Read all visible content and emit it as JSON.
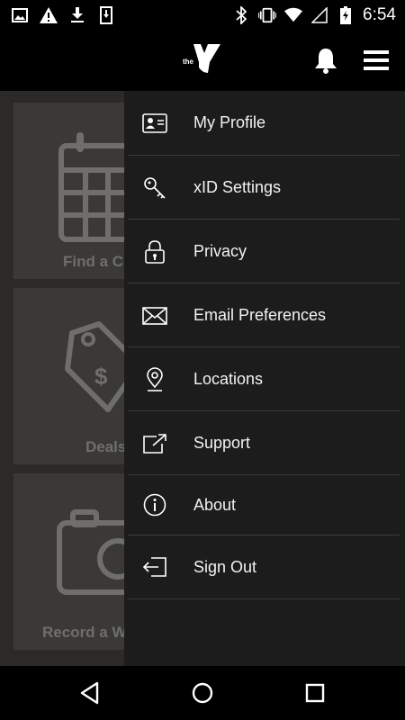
{
  "status_bar": {
    "time": "6:54",
    "icons": [
      "image-icon",
      "warning-icon",
      "download-icon",
      "phone-download-icon",
      "bluetooth-icon",
      "vibrate-icon",
      "wifi-icon",
      "battery-icon"
    ]
  },
  "app_bar": {
    "logo_text": "the",
    "icons": [
      "ymca-logo-icon",
      "bell-icon",
      "hamburger-menu-icon"
    ]
  },
  "background_tiles": [
    {
      "label": "Find a Cl",
      "icon": "calendar-icon"
    },
    {
      "label": "Deals",
      "icon": "price-tag-icon"
    },
    {
      "label": "Record a W",
      "icon": "camera-icon"
    }
  ],
  "drawer": {
    "items": [
      {
        "label": "My Profile",
        "icon": "id-card-icon"
      },
      {
        "label": "xID Settings",
        "icon": "key-icon"
      },
      {
        "label": "Privacy",
        "icon": "lock-icon"
      },
      {
        "label": "Email Preferences",
        "icon": "envelope-icon"
      },
      {
        "label": "Locations",
        "icon": "map-pin-icon"
      },
      {
        "label": "Support",
        "icon": "external-link-icon"
      },
      {
        "label": "About",
        "icon": "info-icon"
      },
      {
        "label": "Sign Out",
        "icon": "sign-out-icon"
      }
    ]
  },
  "nav_bar": {
    "icons": [
      "back-icon",
      "home-icon",
      "recents-icon"
    ]
  },
  "colors": {
    "drawer_bg": "#1c1c1c",
    "tile_bg": "#3a3936",
    "divider": "#3b3b3b"
  }
}
